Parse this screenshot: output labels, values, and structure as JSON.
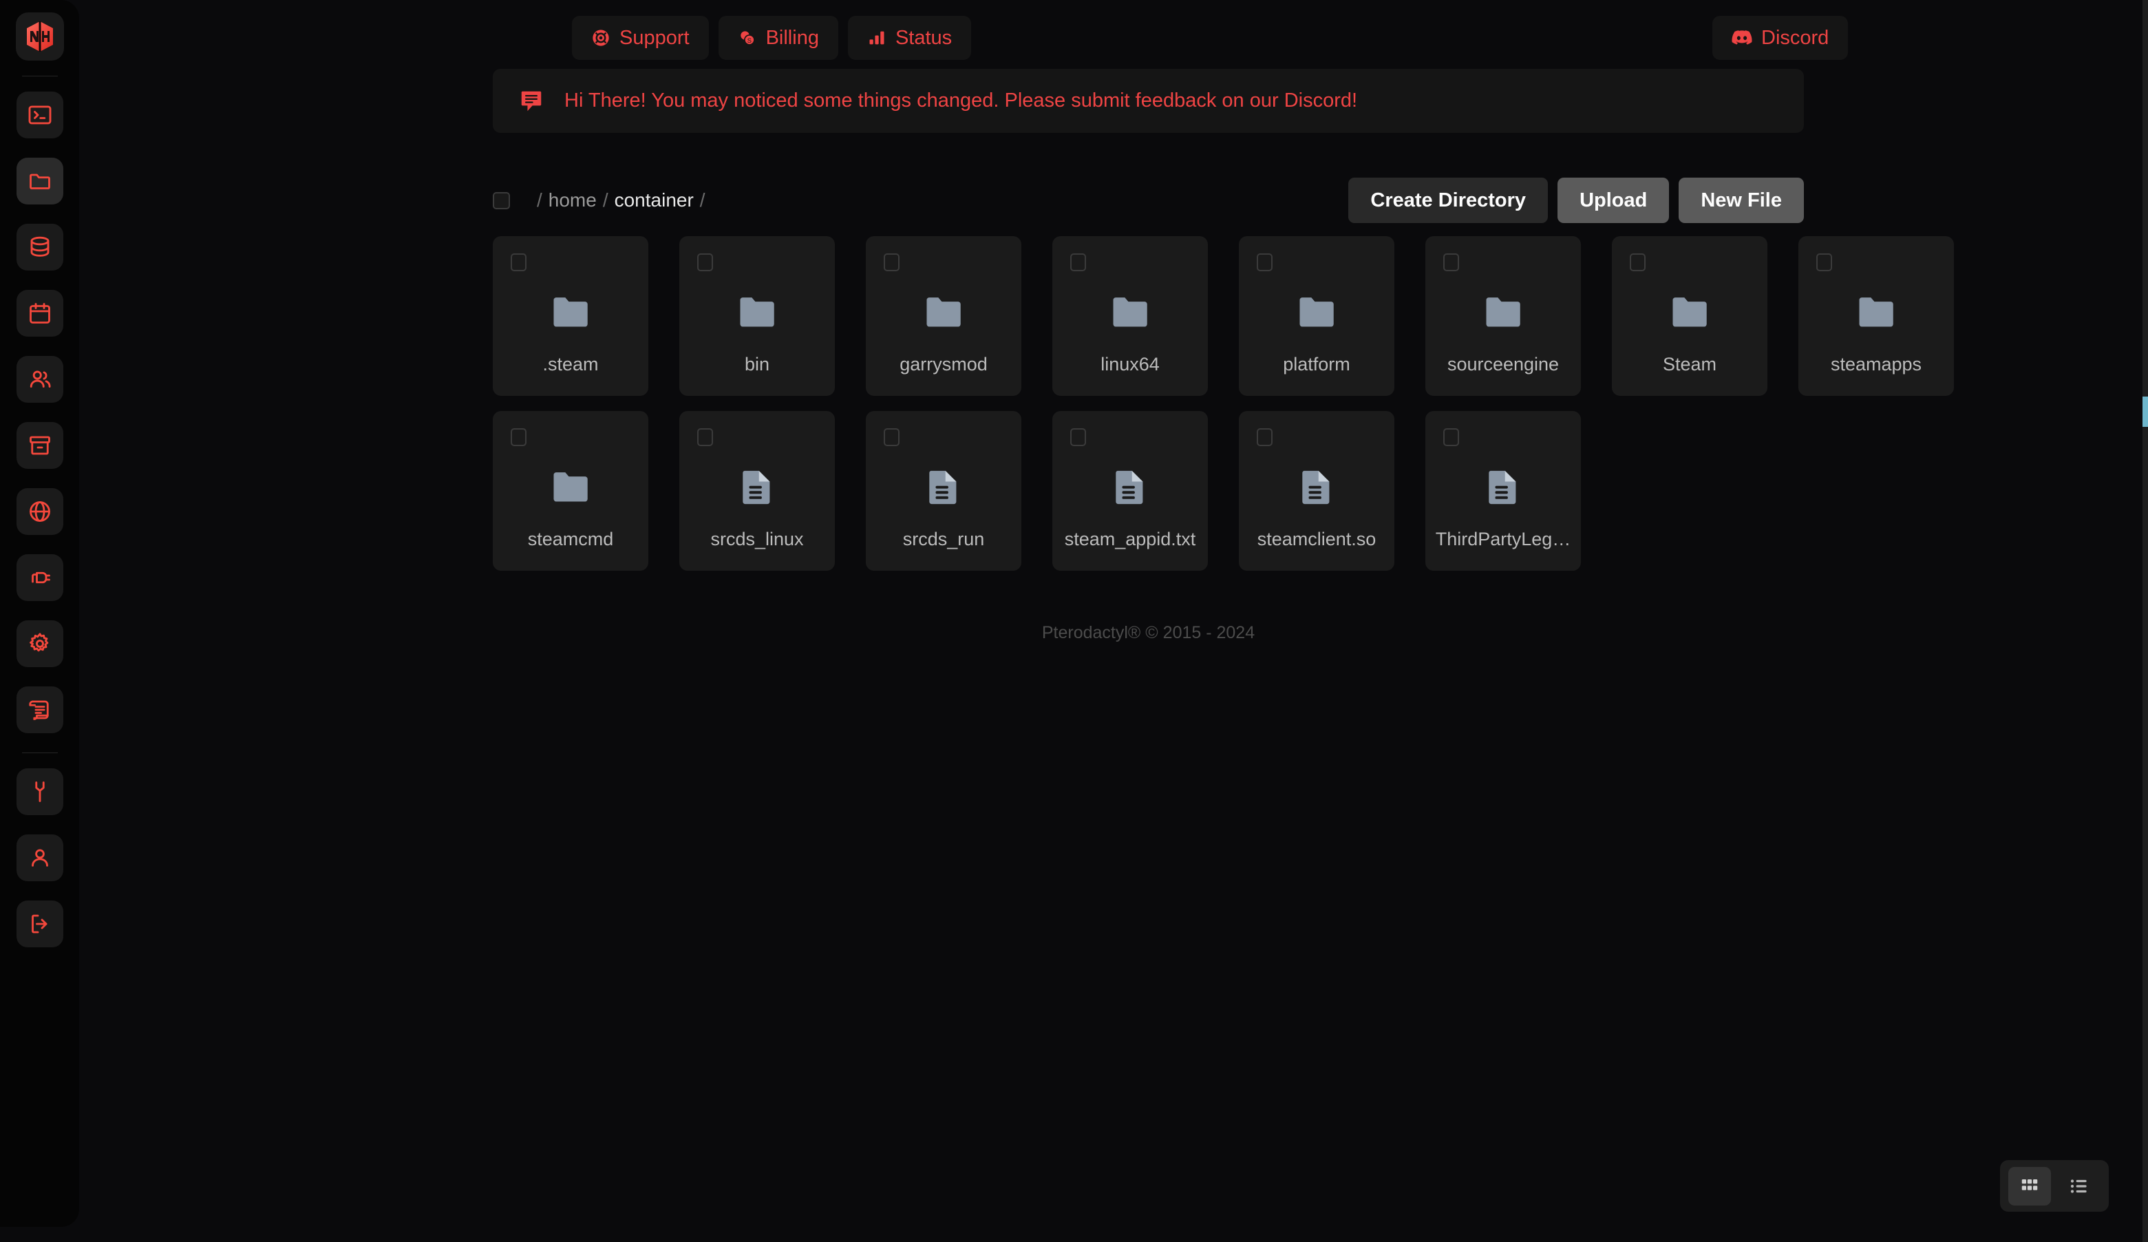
{
  "app": {
    "logo_alt": "NIH logo",
    "footer": "Pterodactyl® © 2015 - 2024"
  },
  "sidebar": {
    "items": [
      {
        "label": "Console",
        "icon": "terminal-icon",
        "active": false
      },
      {
        "label": "Files",
        "icon": "folder-icon",
        "active": true
      },
      {
        "label": "Databases",
        "icon": "database-icon",
        "active": false
      },
      {
        "label": "Schedules",
        "icon": "calendar-icon",
        "active": false
      },
      {
        "label": "Users",
        "icon": "users-icon",
        "active": false
      },
      {
        "label": "Backups",
        "icon": "archive-icon",
        "active": false
      },
      {
        "label": "Network",
        "icon": "globe-icon",
        "active": false
      },
      {
        "label": "Startup",
        "icon": "plug-icon",
        "active": false
      },
      {
        "label": "Settings",
        "icon": "gear-icon",
        "active": false
      },
      {
        "label": "Activity",
        "icon": "scroll-icon",
        "active": false
      },
      {
        "label": "Admin",
        "icon": "wrench-icon",
        "active": false
      },
      {
        "label": "Account",
        "icon": "user-icon",
        "active": false
      },
      {
        "label": "Logout",
        "icon": "logout-icon",
        "active": false
      }
    ]
  },
  "topbar": {
    "links": [
      {
        "label": "Support",
        "icon": "lifebuoy-icon"
      },
      {
        "label": "Billing",
        "icon": "coins-icon"
      },
      {
        "label": "Status",
        "icon": "bars-icon"
      }
    ],
    "discord": {
      "label": "Discord",
      "icon": "discord-icon"
    }
  },
  "banner": {
    "icon": "comment-icon",
    "text": "Hi There! You may noticed some things changed. Please submit feedback on our Discord!"
  },
  "breadcrumb": {
    "select_all_label": "Select all",
    "separator": "/",
    "segments": [
      {
        "label": "home",
        "current": false
      },
      {
        "label": "container",
        "current": true
      }
    ]
  },
  "actions": [
    {
      "label": "Create Directory",
      "style": "dark"
    },
    {
      "label": "Upload",
      "style": "grey"
    },
    {
      "label": "New File",
      "style": "grey"
    }
  ],
  "files": [
    {
      "name": ".steam",
      "type": "folder"
    },
    {
      "name": "bin",
      "type": "folder"
    },
    {
      "name": "garrysmod",
      "type": "folder"
    },
    {
      "name": "linux64",
      "type": "folder"
    },
    {
      "name": "platform",
      "type": "folder"
    },
    {
      "name": "sourceengine",
      "type": "folder"
    },
    {
      "name": "Steam",
      "type": "folder"
    },
    {
      "name": "steamapps",
      "type": "folder"
    },
    {
      "name": "steamcmd",
      "type": "folder"
    },
    {
      "name": "srcds_linux",
      "type": "file"
    },
    {
      "name": "srcds_run",
      "type": "file"
    },
    {
      "name": "steam_appid.txt",
      "type": "file"
    },
    {
      "name": "steamclient.so",
      "type": "file"
    },
    {
      "name": "ThirdPartyLeg…",
      "type": "file"
    }
  ],
  "view_toggle": {
    "grid": {
      "label": "Grid view",
      "icon": "grid-icon",
      "active": true
    },
    "list": {
      "label": "List view",
      "icon": "list-icon",
      "active": false
    }
  },
  "colors": {
    "accent": "#ef4444",
    "sidebar_bg": "#050505",
    "page_bg": "#0f0f0f",
    "card_bg": "#1b1b1b",
    "file_icon": "#8a97a6"
  }
}
